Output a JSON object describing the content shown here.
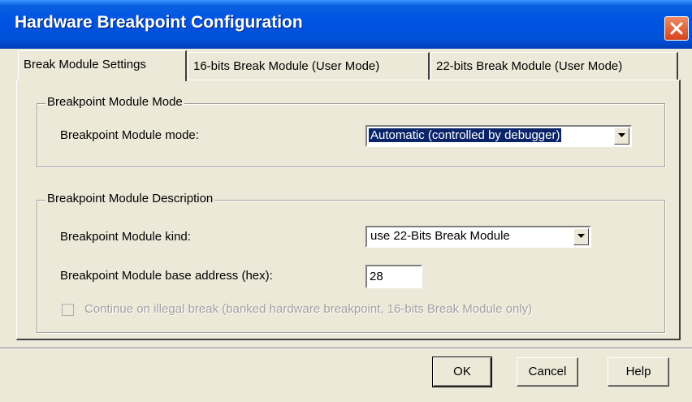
{
  "window": {
    "title": "Hardware Breakpoint Configuration",
    "close_icon": "close-icon"
  },
  "tabs": [
    {
      "label": "Break Module Settings",
      "active": true
    },
    {
      "label": "16-bits Break Module (User Mode)",
      "active": false
    },
    {
      "label": "22-bits Break Module (User Mode)",
      "active": false
    }
  ],
  "mode_group": {
    "title": "Breakpoint Module Mode",
    "mode_label": "Breakpoint Module mode:",
    "mode_value": "Automatic (controlled by debugger)"
  },
  "desc_group": {
    "title": "Breakpoint Module Description",
    "kind_label": "Breakpoint Module kind:",
    "kind_value": "use 22-Bits Break Module",
    "address_label": "Breakpoint Module base address (hex):",
    "address_value": "28",
    "continue_label": "Continue on illegal break (banked hardware breakpoint, 16-bits Break Module only)",
    "continue_checked": false
  },
  "buttons": {
    "ok": "OK",
    "cancel": "Cancel",
    "help": "Help"
  }
}
